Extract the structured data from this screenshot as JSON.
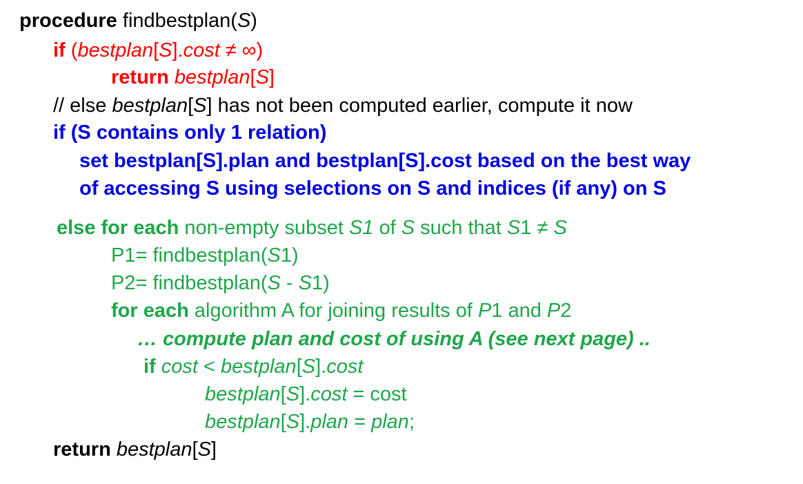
{
  "lines": [
    {
      "id": "line-procedure",
      "color": "#000000",
      "segments": [
        {
          "text": "procedure",
          "bold": true,
          "italic": false
        },
        {
          "text": " findbestplan(",
          "bold": false,
          "italic": false
        },
        {
          "text": "S",
          "bold": false,
          "italic": true
        },
        {
          "text": ")",
          "bold": false,
          "italic": false
        }
      ]
    },
    {
      "id": "line-if-cost",
      "color": "#ff0000",
      "segments": [
        {
          "text": "if",
          "bold": true,
          "italic": false
        },
        {
          "text": " (",
          "bold": false,
          "italic": false
        },
        {
          "text": "bestplan",
          "bold": false,
          "italic": true
        },
        {
          "text": "[",
          "bold": false,
          "italic": false
        },
        {
          "text": "S",
          "bold": false,
          "italic": true
        },
        {
          "text": "].",
          "bold": false,
          "italic": false
        },
        {
          "text": "cost",
          "bold": false,
          "italic": true
        },
        {
          "text": " ≠ ∞)",
          "bold": false,
          "italic": false
        }
      ]
    },
    {
      "id": "line-return-early",
      "color": "#ff0000",
      "segments": [
        {
          "text": "return",
          "bold": true,
          "italic": false
        },
        {
          "text": " ",
          "bold": false,
          "italic": false
        },
        {
          "text": "bestplan",
          "bold": false,
          "italic": true
        },
        {
          "text": "[",
          "bold": false,
          "italic": false
        },
        {
          "text": "S",
          "bold": false,
          "italic": true
        },
        {
          "text": "]",
          "bold": false,
          "italic": false
        }
      ]
    },
    {
      "id": "line-comment",
      "color": "#000000",
      "segments": [
        {
          "text": "// else ",
          "bold": false,
          "italic": false
        },
        {
          "text": "bestplan",
          "bold": false,
          "italic": true
        },
        {
          "text": "[",
          "bold": false,
          "italic": false
        },
        {
          "text": "S",
          "bold": false,
          "italic": true
        },
        {
          "text": "] has not been computed earlier, compute it now",
          "bold": false,
          "italic": false
        }
      ]
    },
    {
      "id": "line-if-single",
      "color": "#0000e0",
      "segments": [
        {
          "text": "if (S contains only 1 relation)",
          "bold": true,
          "italic": false
        }
      ]
    },
    {
      "id": "line-set-bestplan",
      "color": "#0000e0",
      "segments": [
        {
          "text": "set bestplan[S].plan and bestplan[S].cost based on the best way",
          "bold": true,
          "italic": false
        }
      ]
    },
    {
      "id": "line-accessing",
      "color": "#0000e0",
      "segments": [
        {
          "text": "of accessing S  using selections on S and indices (if any) on S",
          "bold": true,
          "italic": false
        }
      ]
    },
    {
      "id": "line-else-for",
      "color": "#1fa64a",
      "segments": [
        {
          "text": "else for each",
          "bold": true,
          "italic": false
        },
        {
          "text": " non-empty subset ",
          "bold": false,
          "italic": false
        },
        {
          "text": "S1",
          "bold": false,
          "italic": true
        },
        {
          "text": " of ",
          "bold": false,
          "italic": false
        },
        {
          "text": "S",
          "bold": false,
          "italic": true
        },
        {
          "text": " such that ",
          "bold": false,
          "italic": false
        },
        {
          "text": "S",
          "bold": false,
          "italic": true
        },
        {
          "text": "1 ≠ ",
          "bold": false,
          "italic": false
        },
        {
          "text": "S",
          "bold": false,
          "italic": true
        }
      ]
    },
    {
      "id": "line-p1",
      "color": "#1fa64a",
      "segments": [
        {
          "text": "P1= findbestplan(",
          "bold": false,
          "italic": false
        },
        {
          "text": "S",
          "bold": false,
          "italic": true
        },
        {
          "text": "1)",
          "bold": false,
          "italic": false
        }
      ]
    },
    {
      "id": "line-p2",
      "color": "#1fa64a",
      "segments": [
        {
          "text": "P2= findbestplan(",
          "bold": false,
          "italic": false
        },
        {
          "text": "S",
          "bold": false,
          "italic": true
        },
        {
          "text": " - ",
          "bold": false,
          "italic": false
        },
        {
          "text": "S",
          "bold": false,
          "italic": true
        },
        {
          "text": "1)",
          "bold": false,
          "italic": false
        }
      ]
    },
    {
      "id": "line-for-each-algorithm",
      "color": "#1fa64a",
      "segments": [
        {
          "text": "for each",
          "bold": true,
          "italic": false
        },
        {
          "text": " algorithm A for joining results of ",
          "bold": false,
          "italic": false
        },
        {
          "text": "P",
          "bold": false,
          "italic": true
        },
        {
          "text": "1 and ",
          "bold": false,
          "italic": false
        },
        {
          "text": "P",
          "bold": false,
          "italic": true
        },
        {
          "text": "2",
          "bold": false,
          "italic": false
        }
      ]
    },
    {
      "id": "line-compute-plan",
      "color": "#1fa64a",
      "segments": [
        {
          "text": "… compute plan and cost of using A (see next page) ..",
          "bold": true,
          "italic": true
        }
      ]
    },
    {
      "id": "line-if-cost-less",
      "color": "#1fa64a",
      "segments": [
        {
          "text": "if",
          "bold": true,
          "italic": false
        },
        {
          "text": " ",
          "bold": false,
          "italic": false
        },
        {
          "text": "cost",
          "bold": false,
          "italic": true
        },
        {
          "text": " < ",
          "bold": false,
          "italic": false
        },
        {
          "text": "bestplan",
          "bold": false,
          "italic": true
        },
        {
          "text": "[",
          "bold": false,
          "italic": false
        },
        {
          "text": "S",
          "bold": false,
          "italic": true
        },
        {
          "text": "].",
          "bold": false,
          "italic": false
        },
        {
          "text": "cost",
          "bold": false,
          "italic": true
        }
      ]
    },
    {
      "id": "line-assign-cost",
      "color": "#1fa64a",
      "segments": [
        {
          "text": "bestplan",
          "bold": false,
          "italic": true
        },
        {
          "text": "[",
          "bold": false,
          "italic": false
        },
        {
          "text": "S",
          "bold": false,
          "italic": true
        },
        {
          "text": "].",
          "bold": false,
          "italic": false
        },
        {
          "text": "cost",
          "bold": false,
          "italic": true
        },
        {
          "text": " = cost",
          "bold": false,
          "italic": false
        }
      ]
    },
    {
      "id": "line-assign-plan",
      "color": "#1fa64a",
      "segments": [
        {
          "text": "bestplan",
          "bold": false,
          "italic": true
        },
        {
          "text": "[",
          "bold": false,
          "italic": false
        },
        {
          "text": "S",
          "bold": false,
          "italic": true
        },
        {
          "text": "].",
          "bold": false,
          "italic": false
        },
        {
          "text": "plan",
          "bold": false,
          "italic": true
        },
        {
          "text": " = ",
          "bold": false,
          "italic": false
        },
        {
          "text": "plan",
          "bold": false,
          "italic": true
        },
        {
          "text": ";",
          "bold": false,
          "italic": false
        }
      ]
    },
    {
      "id": "line-return-final",
      "color": "#000000",
      "segments": [
        {
          "text": "return",
          "bold": true,
          "italic": false
        },
        {
          "text": " ",
          "bold": false,
          "italic": false
        },
        {
          "text": "bestplan",
          "bold": false,
          "italic": true
        },
        {
          "text": "[",
          "bold": false,
          "italic": false
        },
        {
          "text": "S",
          "bold": false,
          "italic": true
        },
        {
          "text": "]",
          "bold": false,
          "italic": false
        }
      ]
    }
  ]
}
